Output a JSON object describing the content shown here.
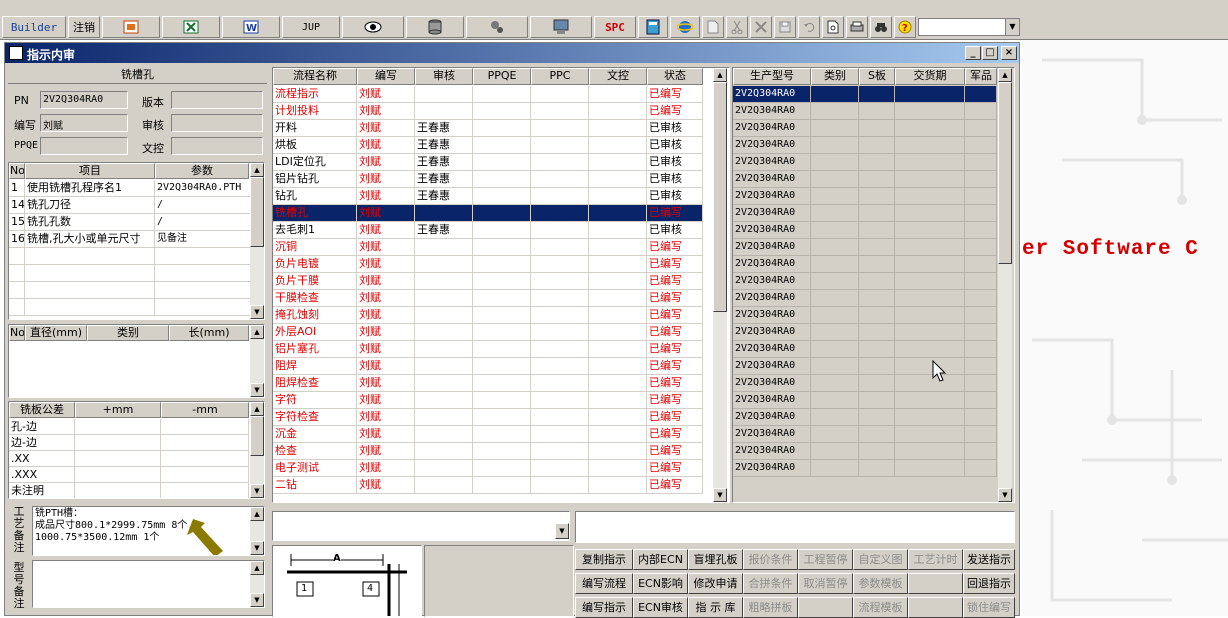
{
  "toolbar": {
    "builder_label": "Builder",
    "logout_label": "注销",
    "jup_label": "JUP",
    "spc_label": "SPC"
  },
  "window": {
    "title": "指示内审"
  },
  "left_panel": {
    "section_title": "铣槽孔",
    "pn_label": "PN",
    "pn_value": "2V2Q304RA0",
    "version_label": "版本",
    "version_value": "",
    "author_label": "编写",
    "author_value": "刘赋",
    "review_label": "审核",
    "review_value": "",
    "ppqe_label": "PPQE",
    "ppqe_value": "",
    "doc_label": "文控",
    "doc_value": "",
    "params_table": {
      "headers": [
        "No",
        "项目",
        "参数"
      ],
      "rows": [
        [
          "1",
          "使用铣槽孔程序名1",
          "2V2Q304RA0.PTH"
        ],
        [
          "14",
          "铣孔刀径",
          "/"
        ],
        [
          "15",
          "铣孔孔数",
          "/"
        ],
        [
          "16",
          "铣槽,孔大小或单元尺寸",
          "见备注"
        ]
      ]
    },
    "dim_table": {
      "headers": [
        "No",
        "直径(mm)",
        "类别",
        "长(mm)"
      ]
    },
    "tolerance_table": {
      "headers": [
        "铣板公差",
        "+mm",
        "-mm"
      ],
      "rows": [
        "孔-边",
        "边-边",
        ".XX",
        ".XXX",
        "未注明"
      ]
    },
    "process_note_label": "工艺备注",
    "process_note_lines": [
      "铣PTH槽：",
      "成品尺寸800.1*2999.75mm  8个,",
      "1000.75*3500.12mm  1个"
    ],
    "model_note_label": "型号备注"
  },
  "flow_table": {
    "headers": [
      "流程名称",
      "编写",
      "审核",
      "PPQE",
      "PPC",
      "文控",
      "状态"
    ],
    "rows": [
      {
        "name": "流程指示",
        "author": "刘赋",
        "reviewer": "",
        "status": "已编写",
        "style": "red"
      },
      {
        "name": "计划投料",
        "author": "刘赋",
        "reviewer": "",
        "status": "已编写",
        "style": "red"
      },
      {
        "name": "开料",
        "author": "刘赋",
        "reviewer": "王春惠",
        "status": "已审核",
        "style": "black"
      },
      {
        "name": "烘板",
        "author": "刘赋",
        "reviewer": "王春惠",
        "status": "已审核",
        "style": "black"
      },
      {
        "name": "LDI定位孔",
        "author": "刘赋",
        "reviewer": "王春惠",
        "status": "已审核",
        "style": "black"
      },
      {
        "name": "铝片钻孔",
        "author": "刘赋",
        "reviewer": "王春惠",
        "status": "已审核",
        "style": "black"
      },
      {
        "name": "钻孔",
        "author": "刘赋",
        "reviewer": "王春惠",
        "status": "已审核",
        "style": "black"
      },
      {
        "name": "铣槽孔",
        "author": "刘赋",
        "reviewer": "",
        "status": "已编写",
        "style": "selected"
      },
      {
        "name": "去毛刺1",
        "author": "刘赋",
        "reviewer": "王春惠",
        "status": "已审核",
        "style": "black"
      },
      {
        "name": "沉铜",
        "author": "刘赋",
        "reviewer": "",
        "status": "已编写",
        "style": "red"
      },
      {
        "name": "负片电镀",
        "author": "刘赋",
        "reviewer": "",
        "status": "已编写",
        "style": "red"
      },
      {
        "name": "负片干膜",
        "author": "刘赋",
        "reviewer": "",
        "status": "已编写",
        "style": "red"
      },
      {
        "name": "干膜检查",
        "author": "刘赋",
        "reviewer": "",
        "status": "已编写",
        "style": "red"
      },
      {
        "name": "掩孔蚀刻",
        "author": "刘赋",
        "reviewer": "",
        "status": "已编写",
        "style": "red"
      },
      {
        "name": "外层AOI",
        "author": "刘赋",
        "reviewer": "",
        "status": "已编写",
        "style": "red"
      },
      {
        "name": "铝片塞孔",
        "author": "刘赋",
        "reviewer": "",
        "status": "已编写",
        "style": "red"
      },
      {
        "name": "阻焊",
        "author": "刘赋",
        "reviewer": "",
        "status": "已编写",
        "style": "red"
      },
      {
        "name": "阻焊检查",
        "author": "刘赋",
        "reviewer": "",
        "status": "已编写",
        "style": "red"
      },
      {
        "name": "字符",
        "author": "刘赋",
        "reviewer": "",
        "status": "已编写",
        "style": "red"
      },
      {
        "name": "字符检查",
        "author": "刘赋",
        "reviewer": "",
        "status": "已编写",
        "style": "red"
      },
      {
        "name": "沉金",
        "author": "刘赋",
        "reviewer": "",
        "status": "已编写",
        "style": "red"
      },
      {
        "name": "检查",
        "author": "刘赋",
        "reviewer": "",
        "status": "已编写",
        "style": "red"
      },
      {
        "name": "电子测试",
        "author": "刘赋",
        "reviewer": "",
        "status": "已编写",
        "style": "red"
      },
      {
        "name": "二钻",
        "author": "刘赋",
        "reviewer": "",
        "status": "已编写",
        "style": "red"
      }
    ]
  },
  "model_table": {
    "headers": [
      "生产型号",
      "类别",
      "S板",
      "交货期",
      "军品"
    ],
    "rows": [
      "2V2Q304RA0",
      "2V2Q304RA0",
      "2V2Q304RA0",
      "2V2Q304RA0",
      "2V2Q304RA0",
      "2V2Q304RA0",
      "2V2Q304RA0",
      "2V2Q304RA0",
      "2V2Q304RA0",
      "2V2Q304RA0",
      "2V2Q304RA0",
      "2V2Q304RA0",
      "2V2Q304RA0",
      "2V2Q304RA0",
      "2V2Q304RA0",
      "2V2Q304RA0",
      "2V2Q304RA0",
      "2V2Q304RA0",
      "2V2Q304RA0",
      "2V2Q304RA0",
      "2V2Q304RA0",
      "2V2Q304RA0",
      "2V2Q304RA0"
    ]
  },
  "drawing": {
    "label_a": "A",
    "box1": "1",
    "box4": "4"
  },
  "buttons": {
    "row1": [
      {
        "label": "复制指示",
        "enabled": true
      },
      {
        "label": "内部ECN",
        "enabled": true
      },
      {
        "label": "盲埋孔板",
        "enabled": true
      },
      {
        "label": "报价条件",
        "enabled": false
      },
      {
        "label": "工程暂停",
        "enabled": false
      },
      {
        "label": "自定义图",
        "enabled": false
      },
      {
        "label": "工艺计时",
        "enabled": false
      },
      {
        "label": "发送指示",
        "enabled": true
      }
    ],
    "row2": [
      {
        "label": "编写流程",
        "enabled": true
      },
      {
        "label": "ECN影响",
        "enabled": true
      },
      {
        "label": "修改申请",
        "enabled": true
      },
      {
        "label": "合拼条件",
        "enabled": false
      },
      {
        "label": "取消暂停",
        "enabled": false
      },
      {
        "label": "参数模板",
        "enabled": false
      },
      {
        "label": "",
        "enabled": false
      },
      {
        "label": "回退指示",
        "enabled": true
      }
    ],
    "row3": [
      {
        "label": "编写指示",
        "enabled": true
      },
      {
        "label": "ECN审核",
        "enabled": true
      },
      {
        "label": "指 示 库",
        "enabled": true
      },
      {
        "label": "粗略拼板",
        "enabled": false
      },
      {
        "label": "",
        "enabled": false
      },
      {
        "label": "流程模板",
        "enabled": false
      },
      {
        "label": "",
        "enabled": false
      },
      {
        "label": "锁住编写",
        "enabled": false
      }
    ]
  },
  "background": {
    "text": "er Software C"
  }
}
